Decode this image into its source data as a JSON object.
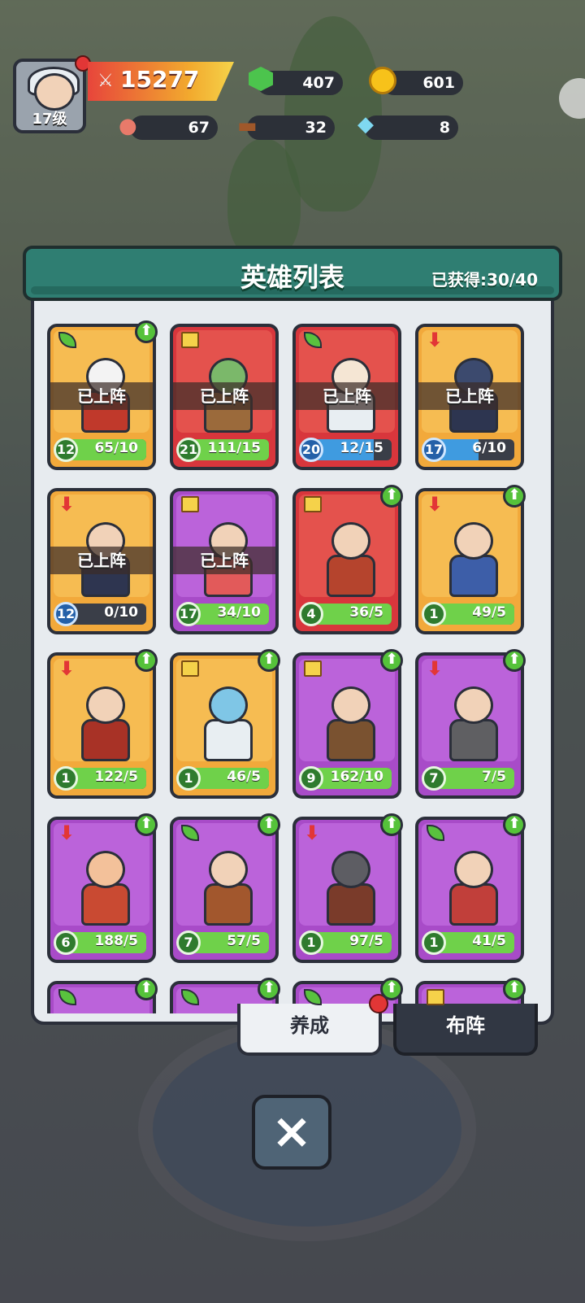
{
  "hud": {
    "player_level": "17级",
    "power": "15277",
    "gems": "407",
    "gold": "601",
    "meat": "67",
    "wood": "32",
    "crystal": "8"
  },
  "panel": {
    "title": "英雄列表",
    "collected_label": "已获得:",
    "collected_value": "30/40"
  },
  "deployed_label": "已上阵",
  "heroes": [
    {
      "level": "12",
      "progress": "65/10",
      "deployed": true,
      "rarity": "orange",
      "icon": "leaf-icon",
      "upgrade": true,
      "fill": 100,
      "bar": "green",
      "skin": "#f3f3f3",
      "outfit": "#c0392b"
    },
    {
      "level": "21",
      "progress": "111/15",
      "deployed": true,
      "rarity": "red",
      "icon": "book-icon",
      "upgrade": false,
      "fill": 100,
      "bar": "green",
      "skin": "#7bb86a",
      "outfit": "#9b6a3b"
    },
    {
      "level": "20",
      "progress": "12/15",
      "deployed": true,
      "rarity": "red",
      "icon": "leaf-icon",
      "upgrade": false,
      "fill": 80,
      "bar": "blue",
      "skin": "#f5e6d4",
      "outfit": "#e8eef2"
    },
    {
      "level": "17",
      "progress": "6/10",
      "deployed": true,
      "rarity": "orange",
      "icon": "red-arrow-icon",
      "upgrade": false,
      "fill": 60,
      "bar": "blue",
      "skin": "#3c4a6e",
      "outfit": "#2d3550"
    },
    {
      "level": "12",
      "progress": "0/10",
      "deployed": true,
      "rarity": "orange",
      "icon": "red-arrow-icon",
      "upgrade": false,
      "fill": 0,
      "bar": "blue",
      "skin": "#f1d2b8",
      "outfit": "#2e3550"
    },
    {
      "level": "17",
      "progress": "34/10",
      "deployed": true,
      "rarity": "purple",
      "icon": "book-icon",
      "upgrade": false,
      "fill": 100,
      "bar": "green",
      "skin": "#f1d2b8",
      "outfit": "#e25a5a"
    },
    {
      "level": "4",
      "progress": "36/5",
      "deployed": false,
      "rarity": "red",
      "icon": "book-icon",
      "upgrade": true,
      "fill": 100,
      "bar": "green",
      "skin": "#f1d2b8",
      "outfit": "#b5442d"
    },
    {
      "level": "1",
      "progress": "49/5",
      "deployed": false,
      "rarity": "orange",
      "icon": "red-arrow-icon",
      "upgrade": true,
      "fill": 100,
      "bar": "green",
      "skin": "#f1d2b8",
      "outfit": "#3d5ea8"
    },
    {
      "level": "1",
      "progress": "122/5",
      "deployed": false,
      "rarity": "orange",
      "icon": "red-arrow-icon",
      "upgrade": true,
      "fill": 100,
      "bar": "green",
      "skin": "#f1d2b8",
      "outfit": "#a83226"
    },
    {
      "level": "1",
      "progress": "46/5",
      "deployed": false,
      "rarity": "orange",
      "icon": "book-icon",
      "upgrade": true,
      "fill": 100,
      "bar": "green",
      "skin": "#7fc6e6",
      "outfit": "#e8eef2"
    },
    {
      "level": "9",
      "progress": "162/10",
      "deployed": false,
      "rarity": "purple",
      "icon": "book-icon",
      "upgrade": true,
      "fill": 100,
      "bar": "green",
      "skin": "#f1d2b8",
      "outfit": "#7a5230"
    },
    {
      "level": "7",
      "progress": "7/5",
      "deployed": false,
      "rarity": "purple",
      "icon": "red-arrow-icon",
      "upgrade": true,
      "fill": 100,
      "bar": "green",
      "skin": "#f1d2b8",
      "outfit": "#5f5f62"
    },
    {
      "level": "6",
      "progress": "188/5",
      "deployed": false,
      "rarity": "purple",
      "icon": "red-arrow-icon",
      "upgrade": true,
      "fill": 100,
      "bar": "green",
      "skin": "#f3c19a",
      "outfit": "#c94a32"
    },
    {
      "level": "7",
      "progress": "57/5",
      "deployed": false,
      "rarity": "purple",
      "icon": "leaf-icon",
      "upgrade": true,
      "fill": 100,
      "bar": "green",
      "skin": "#f1d2b8",
      "outfit": "#a2572d"
    },
    {
      "level": "1",
      "progress": "97/5",
      "deployed": false,
      "rarity": "purple",
      "icon": "red-arrow-icon",
      "upgrade": true,
      "fill": 100,
      "bar": "green",
      "skin": "#5d5d63",
      "outfit": "#7a3b2a"
    },
    {
      "level": "1",
      "progress": "41/5",
      "deployed": false,
      "rarity": "purple",
      "icon": "leaf-icon",
      "upgrade": true,
      "fill": 100,
      "bar": "green",
      "skin": "#f1d2b8",
      "outfit": "#c13f3a"
    },
    {
      "level": "",
      "progress": "",
      "deployed": false,
      "rarity": "purple",
      "icon": "leaf-icon",
      "upgrade": true,
      "fill": 0,
      "bar": "green",
      "skin": "#f1d2b8",
      "outfit": "#bb63da"
    },
    {
      "level": "",
      "progress": "",
      "deployed": false,
      "rarity": "purple",
      "icon": "leaf-icon",
      "upgrade": true,
      "fill": 0,
      "bar": "green",
      "skin": "#f1d2b8",
      "outfit": "#bb63da"
    },
    {
      "level": "",
      "progress": "",
      "deployed": false,
      "rarity": "purple",
      "icon": "leaf-icon",
      "upgrade": true,
      "fill": 0,
      "bar": "green",
      "skin": "#f1d2b8",
      "outfit": "#bb63da"
    },
    {
      "level": "",
      "progress": "",
      "deployed": false,
      "rarity": "purple",
      "icon": "book-icon",
      "upgrade": true,
      "fill": 0,
      "bar": "green",
      "skin": "#f1d2b8",
      "outfit": "#bb63da"
    }
  ],
  "tabs": {
    "foster": "养成",
    "formation": "布阵"
  },
  "close_icon": "×"
}
